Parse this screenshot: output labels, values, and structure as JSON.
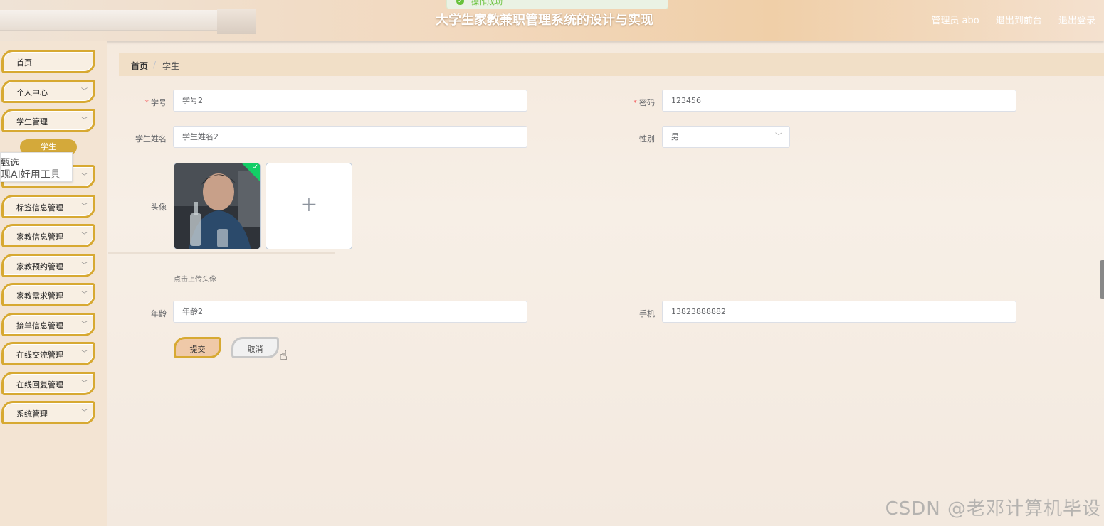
{
  "header": {
    "title": "大学生家教兼职管理系统的设计与实现",
    "toast": "操作成功",
    "user_label": "管理员 abo",
    "back_label": "退出到前台",
    "logout_label": "退出登录"
  },
  "sidebar": {
    "items": [
      {
        "label": "首页"
      },
      {
        "label": "个人中心"
      },
      {
        "label": "学生管理"
      },
      {
        "label": ""
      },
      {
        "label": "标签信息管理"
      },
      {
        "label": "家教信息管理"
      },
      {
        "label": "家教预约管理"
      },
      {
        "label": "家教需求管理"
      },
      {
        "label": "接单信息管理"
      },
      {
        "label": "在线交流管理"
      },
      {
        "label": "在线回复管理"
      },
      {
        "label": "系统管理"
      }
    ],
    "active_sub": "学生",
    "popup_line1": "甄选",
    "popup_line2": "现AI好用工具"
  },
  "breadcrumb": {
    "home": "首页",
    "sep": "/",
    "current": "学生"
  },
  "form": {
    "student_no_label": "学号",
    "student_no_value": "学号2",
    "password_label": "密码",
    "password_value": "123456",
    "name_label": "学生姓名",
    "name_value": "学生姓名2",
    "gender_label": "性别",
    "gender_value": "男",
    "avatar_label": "头像",
    "upload_tip": "点击上传头像",
    "age_label": "年龄",
    "age_value": "年龄2",
    "phone_label": "手机",
    "phone_value": "13823888882",
    "submit_label": "提交",
    "cancel_label": "取消"
  },
  "watermark": "CSDN @老邓计算机毕设",
  "colors": {
    "accent": "#d7a932",
    "success": "#13ce66",
    "required": "#f56c6c"
  }
}
